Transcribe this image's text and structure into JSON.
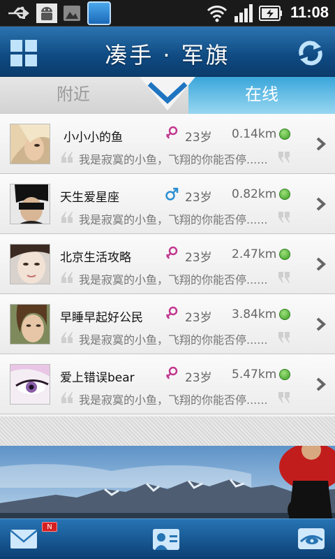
{
  "status_bar": {
    "time": "11:08",
    "icons": [
      "usb-icon",
      "android-debug-icon",
      "gallery-icon",
      "app-notification-icon",
      "wifi-icon",
      "signal-icon",
      "battery-charging-icon"
    ]
  },
  "header": {
    "title": "凑手 · 军旗",
    "left_icon": "grid-icon",
    "right_icon": "refresh-icon"
  },
  "tabs": [
    {
      "label": "附近",
      "active": false
    },
    {
      "label": "在线",
      "active": true
    }
  ],
  "users": [
    {
      "name": "小小小的鱼",
      "gender": "female",
      "age": "23岁",
      "distance": "0.14km",
      "signature": "我是寂寞的小鱼，飞翔的你能否停......"
    },
    {
      "name": "天生爱星座",
      "gender": "male",
      "age": "23岁",
      "distance": "0.82km",
      "signature": "我是寂寞的小鱼，飞翔的你能否停......"
    },
    {
      "name": "北京生活攻略",
      "gender": "female",
      "age": "23岁",
      "distance": "2.47km",
      "signature": "我是寂寞的小鱼，飞翔的你能否停......"
    },
    {
      "name": "早睡早起好公民",
      "gender": "female",
      "age": "23岁",
      "distance": "3.84km",
      "signature": "我是寂寞的小鱼，飞翔的你能否停......"
    },
    {
      "name": "爱上错误bear",
      "gender": "female",
      "age": "23岁",
      "distance": "5.47km",
      "signature": "我是寂寞的小鱼，飞翔的你能否停......"
    }
  ],
  "bottom_bar": {
    "badge": "N",
    "icons": [
      "mail-icon",
      "contact-card-icon",
      "eye-icon"
    ]
  },
  "colors": {
    "header_blue": "#0f4a82",
    "female_pink": "#c2378f",
    "male_blue": "#2a8fd2",
    "online_green": "#3b9e26"
  }
}
